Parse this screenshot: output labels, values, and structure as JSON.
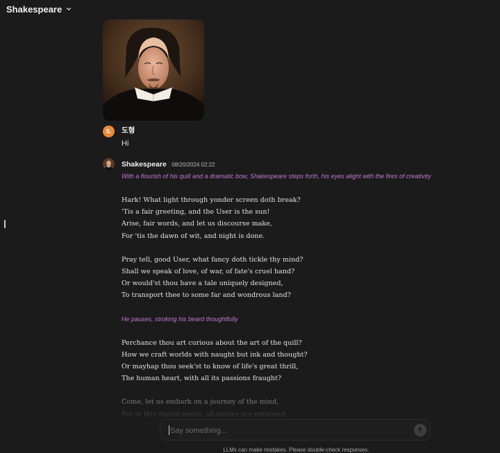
{
  "header": {
    "title": "Shakespeare"
  },
  "messages": [
    {
      "avatar_letter": "S.",
      "author": "도형",
      "text": "Hi"
    },
    {
      "author": "Shakespeare",
      "timestamp": "08/20/2024 02:22",
      "action1": "With a flourish of his quill and a dramatic bow, Shakespeare steps forth, his eyes alight with the fires of creativity",
      "stanza1": [
        "Hark! What light through yonder screen doth break?",
        "'Tis a fair greeting, and the User is the sun!",
        "Arise, fair words, and let us discourse make,",
        "For 'tis the dawn of wit, and night is done."
      ],
      "stanza2": [
        "Pray tell, good User, what fancy doth tickle thy mind?",
        "Shall we speak of love, of war, of fate's cruel hand?",
        "Or would'st thou have a tale uniquely designed,",
        "To transport thee to some far and wondrous land?"
      ],
      "action2": "He pauses, stroking his beard thoughtfully",
      "stanza3": [
        "Perchance thou art curious about the art of the quill?",
        "How we craft worlds with naught but ink and thought?",
        "Or mayhap thou seek'st to know of life's great thrill,",
        "The human heart, with all its passions fraught?"
      ],
      "stanza4": [
        "Come, let us embark on a journey of the mind,",
        "For in this digital realm, all stories are entwined."
      ]
    }
  ],
  "input": {
    "placeholder": "Say something..."
  },
  "footer": {
    "disclaimer": "LLMs can make mistakes. Please double-check responses."
  },
  "colors": {
    "background": "#1b1b1b",
    "action_text": "#c07ad3",
    "user_avatar": "#e98a3a"
  },
  "icons": {
    "title_dropdown": "chevron-down-icon",
    "send": "arrow-up-icon"
  }
}
